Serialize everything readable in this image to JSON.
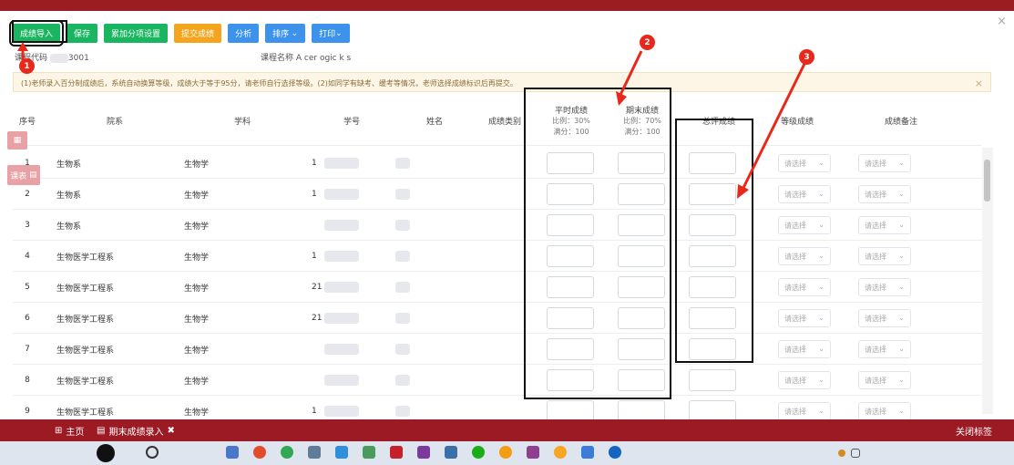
{
  "toolbar": {
    "import": "成绩导入",
    "save": "保存",
    "add_score": "累加分项设置",
    "submit": "提交成绩",
    "analyze": "分析",
    "sort": "排序",
    "print": "打印"
  },
  "meta": {
    "course_code_label": "课程代码",
    "course_code_value": "3001",
    "course_name_label": "课程名称",
    "course_name_value": "A   cer   ogic    k    s"
  },
  "notice": "(1)老师录入百分制成绩后，系统自动换算等级，成绩大于等于95分，请老师自行选择等级。(2)如同学有缺考、缓考等情况，老师选择成绩标识后再提交。",
  "headers": {
    "no": "序号",
    "dept": "院系",
    "subject": "学科",
    "stuid": "学号",
    "name": "姓名",
    "type": "成绩类别",
    "usual": "平时成绩",
    "usual_ratio": "比例：30%",
    "usual_full": "满分：100",
    "final": "期末成绩",
    "final_ratio": "比例：70%",
    "final_full": "满分：100",
    "total": "总评成绩",
    "grade": "等级成绩",
    "remark": "成绩备注"
  },
  "select_placeholder": "请选择",
  "rows": [
    {
      "no": "1",
      "dept": "生物系",
      "subject": "生物学",
      "stuid": "1",
      "name": "1"
    },
    {
      "no": "2",
      "dept": "生物系",
      "subject": "生物学",
      "stuid": "1",
      "name": ""
    },
    {
      "no": "3",
      "dept": "生物系",
      "subject": "生物学",
      "stuid": "",
      "name": ""
    },
    {
      "no": "4",
      "dept": "生物医学工程系",
      "subject": "生物学",
      "stuid": "1",
      "name": ""
    },
    {
      "no": "5",
      "dept": "生物医学工程系",
      "subject": "生物学",
      "stuid": "21",
      "name": ""
    },
    {
      "no": "6",
      "dept": "生物医学工程系",
      "subject": "生物学",
      "stuid": "21",
      "name": ""
    },
    {
      "no": "7",
      "dept": "生物医学工程系",
      "subject": "生物学",
      "stuid": "",
      "name": ""
    },
    {
      "no": "8",
      "dept": "生物医学工程系",
      "subject": "生物学",
      "stuid": "",
      "name": ""
    },
    {
      "no": "9",
      "dept": "生物医学工程系",
      "subject": "生物学",
      "stuid": "1",
      "name": ""
    }
  ],
  "annotations": [
    "1",
    "2",
    "3"
  ],
  "left_float": {
    "timetable": "课表"
  },
  "tabs": {
    "home": "主页",
    "current": "期末成绩录入",
    "close_all": "关闭标签"
  },
  "colors": {
    "header_red": "#9b1c23",
    "green": "#19b560",
    "orange": "#f5a51d",
    "blue": "#3d93ec",
    "annotation_red": "#e8281a"
  }
}
